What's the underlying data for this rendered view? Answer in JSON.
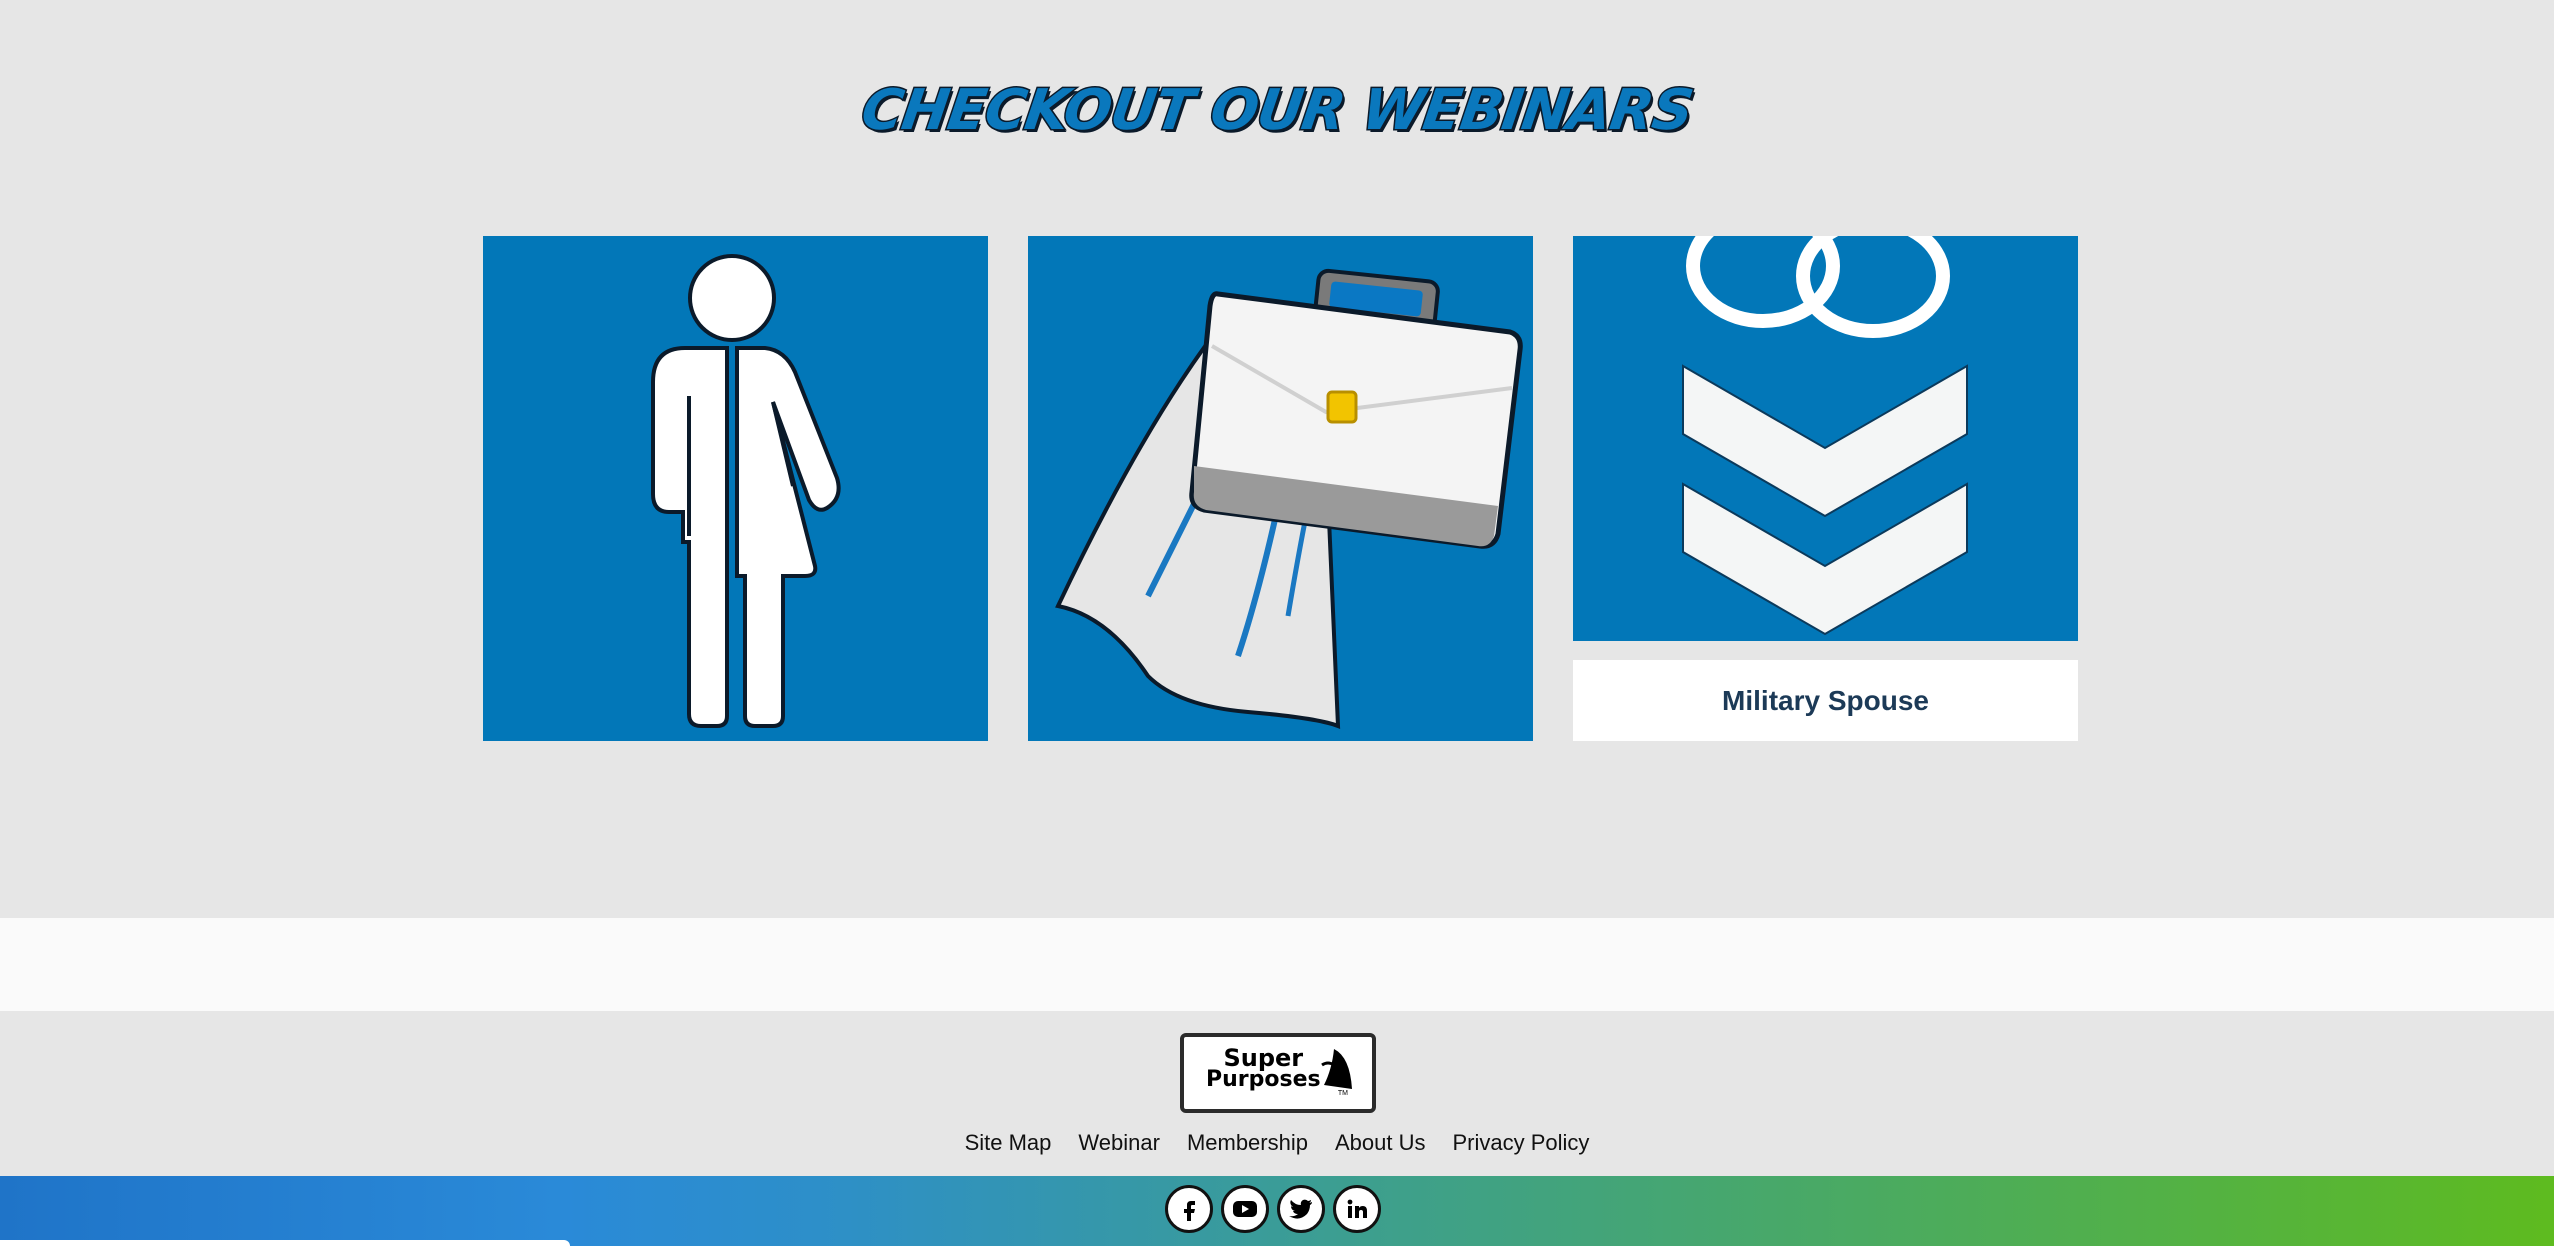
{
  "section": {
    "title": "CHECKOUT OUR WEBINARS"
  },
  "webinars": [
    {
      "icon": "gender-neutral-person-icon",
      "caption": ""
    },
    {
      "icon": "briefcase-cape-icon",
      "caption": ""
    },
    {
      "icon": "military-rings-chevrons-icon",
      "caption": "Military Spouse"
    }
  ],
  "footer": {
    "logo": {
      "line1": "Super",
      "line2": "Purposes",
      "tm": "TM"
    },
    "nav": [
      "Site Map",
      "Webinar",
      "Membership",
      "About Us",
      "Privacy Policy"
    ],
    "social": [
      "facebook-icon",
      "youtube-icon",
      "twitter-icon",
      "linkedin-icon"
    ]
  },
  "colors": {
    "brand_blue": "#0277b8",
    "caption_text": "#1c3a57",
    "background": "#e6e6e6",
    "gradient_start": "#1f74c8",
    "gradient_end": "#5ebb1f"
  }
}
